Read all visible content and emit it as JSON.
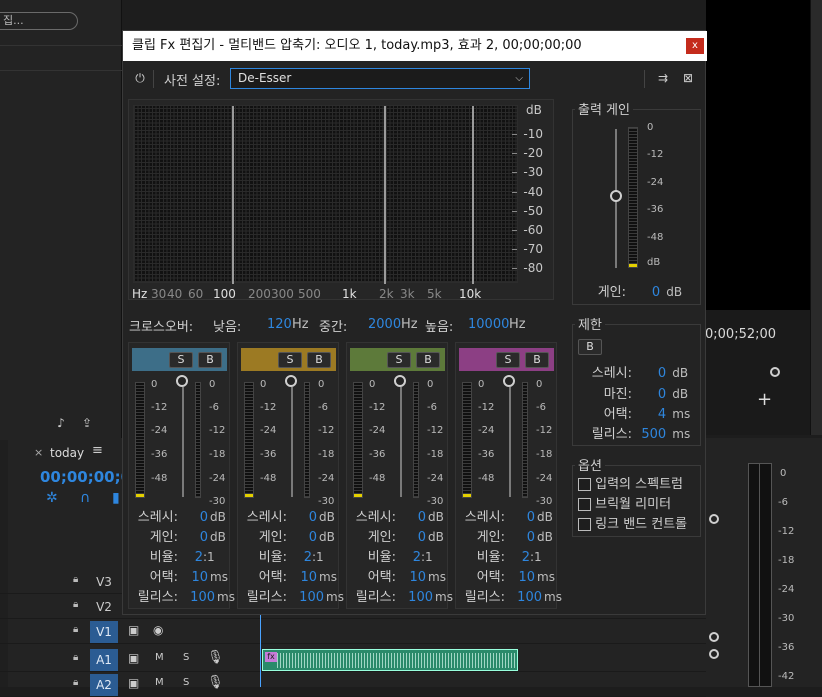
{
  "host": {
    "search_fragment": "집...",
    "right_timecode": "0;00;52;00",
    "sequence": {
      "name": "today",
      "timecode": "00;00;00;00"
    },
    "tracks": [
      {
        "label": "V3"
      },
      {
        "label": "V2"
      },
      {
        "label": "V1"
      },
      {
        "label": "A1"
      },
      {
        "label": "A2"
      }
    ],
    "track_buttons": {
      "mute": "M",
      "solo": "S"
    },
    "clip_fx_badge": "fx",
    "right_meter_ticks": [
      "0",
      "-6",
      "-12",
      "-18",
      "-24",
      "-30",
      "-36",
      "-42"
    ]
  },
  "dialog": {
    "title": "클립 Fx 편집기 - 멀티밴드 압축기: 오디오 1, today.mp3, 효과 2, 00;00;00;00",
    "close_label": "x",
    "preset_label": "사전 설정:",
    "preset_value": "De-Esser",
    "graph": {
      "db_title": "dB",
      "db_ticks": [
        "-10",
        "-20",
        "-30",
        "-40",
        "-50",
        "-60",
        "-70",
        "-80"
      ],
      "hz_ticks": [
        {
          "label": "Hz",
          "major": true
        },
        {
          "label": "30",
          "major": false
        },
        {
          "label": "40",
          "major": false
        },
        {
          "label": "60",
          "major": false
        },
        {
          "label": "100",
          "major": true
        },
        {
          "label": "200",
          "major": false
        },
        {
          "label": "300",
          "major": false
        },
        {
          "label": "500",
          "major": false
        },
        {
          "label": "1k",
          "major": true
        },
        {
          "label": "2k",
          "major": false
        },
        {
          "label": "3k",
          "major": false
        },
        {
          "label": "5k",
          "major": false
        },
        {
          "label": "10k",
          "major": true
        }
      ]
    },
    "crossover": {
      "label": "크로스오버:",
      "low_label": "낮음:",
      "low_value": "120",
      "low_unit": "Hz",
      "mid_label": "중간:",
      "mid_value": "2000",
      "mid_unit": "Hz",
      "high_label": "높음:",
      "high_value": "10000",
      "high_unit": "Hz"
    },
    "band_meter_ticks": [
      "0",
      "-12",
      "-24",
      "-36",
      "-48"
    ],
    "band_fader_ticks": [
      "0",
      "-6",
      "-12",
      "-18",
      "-24",
      "-30"
    ],
    "band_buttons": {
      "solo": "S",
      "bypass": "B"
    },
    "param_labels": {
      "threshold": "스레시:",
      "gain": "게인:",
      "ratio": "비율:",
      "attack": "어택:",
      "release": "릴리스:"
    },
    "units": {
      "db": "dB",
      "ms": "ms",
      "ratio": ":1"
    },
    "bands": [
      {
        "color": "#3d6e88",
        "threshold": "0",
        "gain": "0",
        "ratio": "2",
        "attack": "10",
        "release": "100"
      },
      {
        "color": "#9c7a23",
        "threshold": "0",
        "gain": "0",
        "ratio": "2",
        "attack": "10",
        "release": "100"
      },
      {
        "color": "#5d7a3a",
        "threshold": "0",
        "gain": "0",
        "ratio": "2",
        "attack": "10",
        "release": "100"
      },
      {
        "color": "#8c3f84",
        "threshold": "0",
        "gain": "0",
        "ratio": "2",
        "attack": "10",
        "release": "100"
      }
    ],
    "output_gain": {
      "title": "출력 게인",
      "ticks": [
        "0",
        "-12",
        "-24",
        "-36",
        "-48"
      ],
      "db_label": "dB",
      "label": "게인:",
      "value": "0",
      "unit": "dB"
    },
    "limiter": {
      "title": "제한",
      "bypass": "B",
      "threshold_label": "스레시:",
      "threshold_value": "0",
      "threshold_unit": "dB",
      "margin_label": "마진:",
      "margin_value": "0",
      "margin_unit": "dB",
      "attack_label": "어택:",
      "attack_value": "4",
      "attack_unit": "ms",
      "release_label": "릴리스:",
      "release_value": "500",
      "release_unit": "ms"
    },
    "options": {
      "title": "옵션",
      "items": [
        "입력의 스펙트럼",
        "브릭월 리미터",
        "링크 밴드 컨트롤"
      ]
    }
  }
}
